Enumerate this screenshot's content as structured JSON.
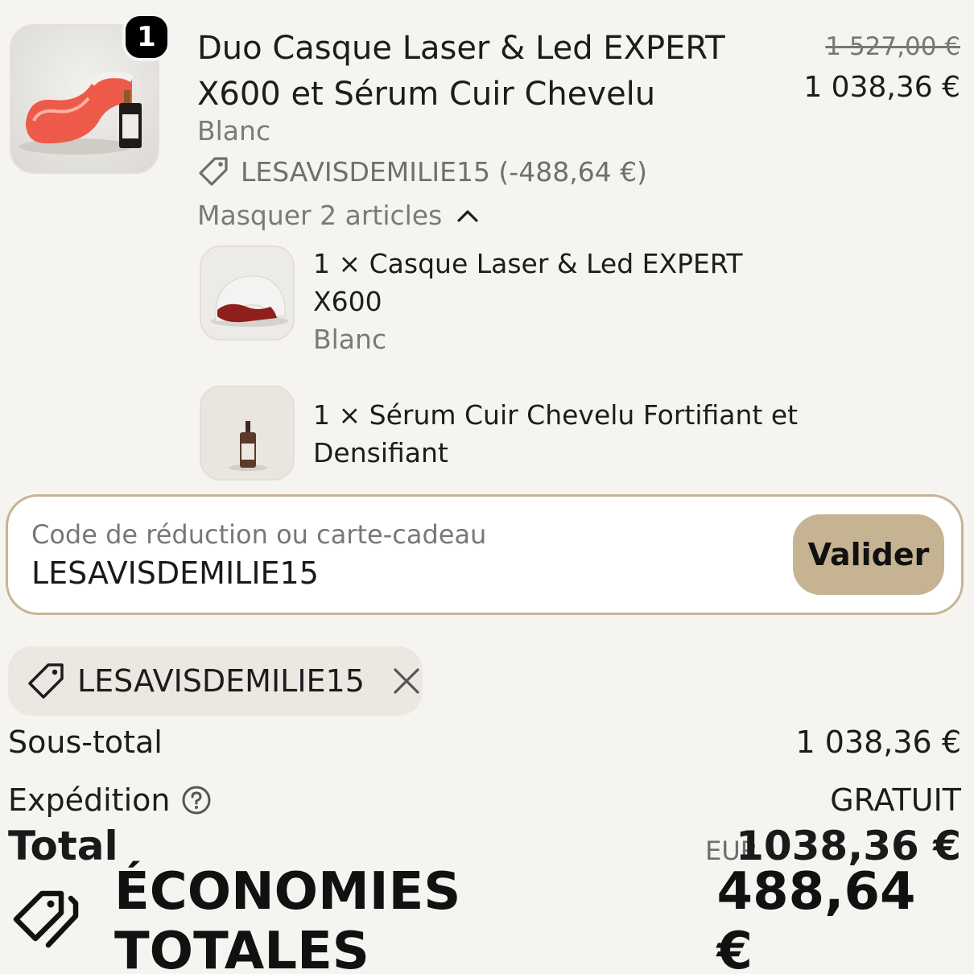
{
  "line_item": {
    "quantity_badge": "1",
    "title": "Duo Casque Laser & Led EXPERT X600 et Sérum Cuir Chevelu",
    "original_price": "1 527,00 €",
    "price": "1 038,36 €",
    "variant": "Blanc",
    "discount_applied": "LESAVISDEMILIE15 (-488,64 €)",
    "toggle_label": "Masquer 2 articles",
    "bundle_items": [
      {
        "label_line1": "1 × Casque Laser & Led EXPERT",
        "label_line2": "X600",
        "variant": "Blanc"
      },
      {
        "label_line1": "1 × Sérum Cuir Chevelu Fortifiant et",
        "label_line2": "Densifiant"
      }
    ]
  },
  "discount_form": {
    "label": "Code de réduction ou carte-cadeau",
    "value": "LESAVISDEMILIE15",
    "submit_label": "Valider",
    "accent_color": "#c6b391"
  },
  "applied_code": {
    "code": "LESAVISDEMILIE15"
  },
  "summary": {
    "subtotal_label": "Sous-total",
    "subtotal_value": "1 038,36 €",
    "shipping_label": "Expédition",
    "shipping_value": "GRATUIT",
    "total_label": "Total",
    "total_currency": "EUR",
    "total_value": "1038,36 €",
    "savings_label": "ÉCONOMIES TOTALES",
    "savings_value": "488,64 €"
  },
  "icons": [
    "tag-icon",
    "chevron-up-icon",
    "close-icon",
    "help-circle-icon",
    "tags-icon"
  ]
}
